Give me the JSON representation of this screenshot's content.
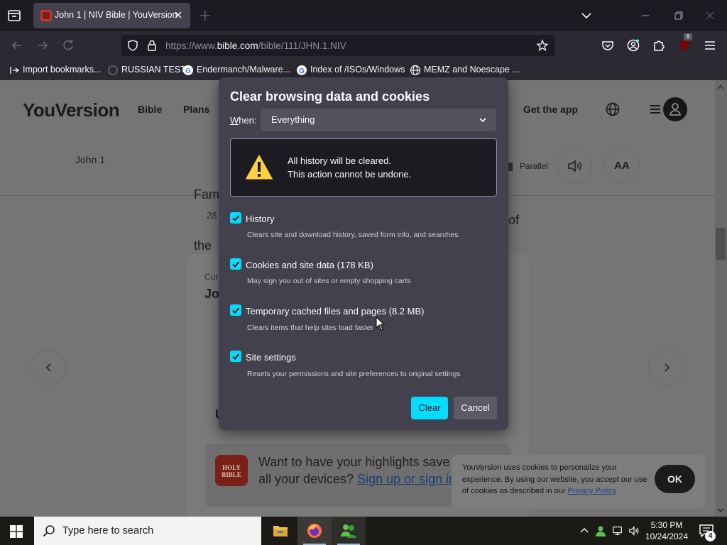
{
  "browser": {
    "tab": {
      "title": "John 1 | NIV Bible | YouVersion"
    },
    "url": {
      "prefix": "https://www.",
      "domain": "bible.com",
      "path": "/bible/111/JHN.1.NIV"
    },
    "extension_badge": "9",
    "bookmarks": [
      {
        "label": "Import bookmarks...",
        "icon": "import-icon"
      },
      {
        "label": "RUSSIAN TEST",
        "icon": "loading-ring-icon"
      },
      {
        "label": "Endermanch/Malware...",
        "icon": "google-icon"
      },
      {
        "label": "Index of /ISOs/Windows",
        "icon": "google-icon"
      },
      {
        "label": "MEMZ and Noescape ...",
        "icon": "globe-icon"
      }
    ]
  },
  "page": {
    "logo": "YouVersion",
    "nav": {
      "bible": "Bible",
      "plans": "Plans",
      "get_app": "Get the app"
    },
    "chapter": "John 1",
    "parallel": "Parallel",
    "font_size_btn": "AA",
    "fragments": {
      "f1": "Fam",
      "f2": "28",
      "f3": "of",
      "f4": "the",
      "f5": "Cur",
      "f6": "Jo",
      "f7": "U"
    },
    "promo": {
      "line1": "Want to have your highlights save",
      "line2_prefix": "all your devices? ",
      "link": "Sign up or sign in"
    },
    "cookie": {
      "text": "YouVersion uses cookies to personalize your experience. By using our website, you accept our use of cookies as described in our ",
      "link": "Privacy Policy",
      "ok": "OK"
    }
  },
  "dialog": {
    "title": "Clear browsing data and cookies",
    "when_label_accesskey": "W",
    "when_label_rest": "hen:",
    "when_value": "Everything",
    "warning_line1": "All history will be cleared.",
    "warning_line2": "This action cannot be undone.",
    "options": [
      {
        "label": "History",
        "desc": "Clears site and download history, saved form info, and searches",
        "checked": true
      },
      {
        "label": "Cookies and site data (178 KB)",
        "desc": "May sign you out of sites or empty shopping carts",
        "checked": true
      },
      {
        "label": "Temporary cached files and pages (8.2 MB)",
        "desc": "Clears items that help sites load faster",
        "checked": true
      },
      {
        "label": "Site settings",
        "desc": "Resets your permissions and site preferences to original settings",
        "checked": true
      }
    ],
    "clear_label": "Clear",
    "cancel_label": "Cancel",
    "accent": "#00ddff"
  },
  "taskbar": {
    "search_placeholder": "Type here to search",
    "time": "5:30 PM",
    "date": "10/24/2024",
    "notification_count": "4"
  }
}
